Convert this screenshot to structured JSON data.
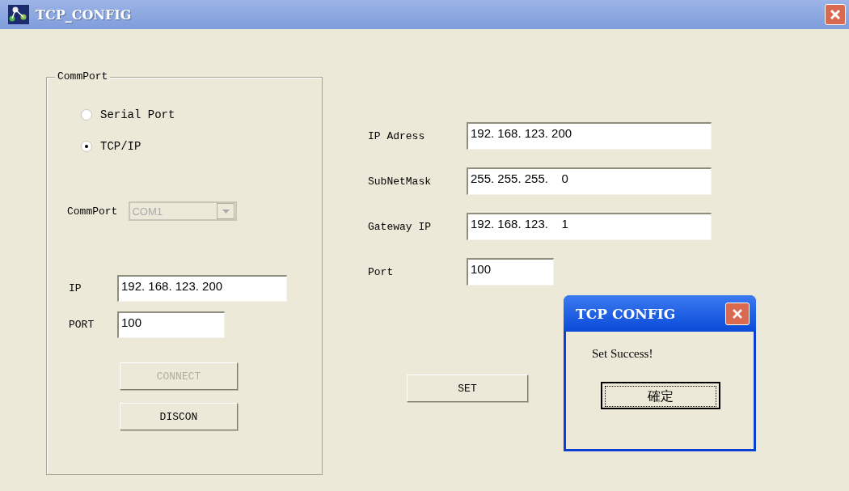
{
  "window": {
    "title": "TCP_CONFIG"
  },
  "commport_group": {
    "title": "CommPort",
    "options": [
      {
        "label": "Serial Port",
        "selected": false
      },
      {
        "label": "TCP/IP",
        "selected": true
      }
    ],
    "commport": {
      "label": "CommPort",
      "value": "COM1",
      "disabled": true
    },
    "fields": [
      {
        "label": "IP",
        "value": "192. 168. 123. 200"
      },
      {
        "label": "PORT",
        "value": "100"
      }
    ],
    "buttons": [
      {
        "label": "CONNECT",
        "disabled": true
      },
      {
        "label": "DISCON",
        "disabled": false
      }
    ]
  },
  "settings": {
    "fields": [
      {
        "label": "IP Adress",
        "value": "192. 168. 123. 200",
        "kind": "wide"
      },
      {
        "label": "SubNetMask",
        "value": "255. 255. 255.    0",
        "kind": "wide"
      },
      {
        "label": "Gateway IP",
        "value": "192. 168. 123.    1",
        "kind": "wide"
      },
      {
        "label": "Port",
        "value": "100",
        "kind": "short"
      }
    ],
    "set_button": "SET"
  },
  "dialog": {
    "title": "TCP CONFIG",
    "message": "Set Success!",
    "button": "確定"
  }
}
